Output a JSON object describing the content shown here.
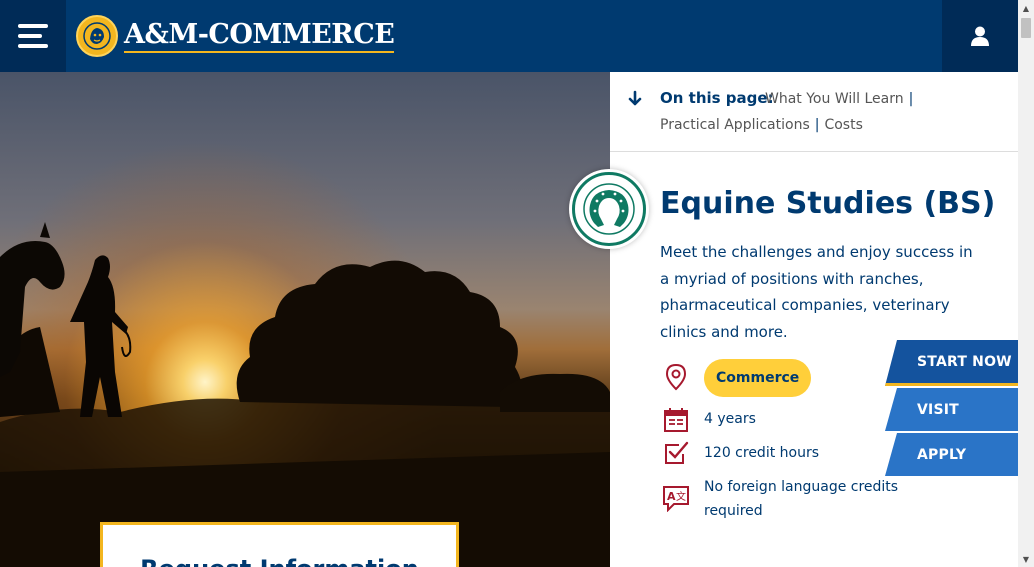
{
  "header": {
    "logo_text": "A&M-COMMERCE",
    "menu_icon": "hamburger-icon",
    "user_icon": "user-icon",
    "bg_color": "#003a70",
    "accent_color": "#f3b61f"
  },
  "on_this_page": {
    "label": "On this page:",
    "links": [
      "What You Will Learn",
      "Practical Applications",
      "Costs"
    ]
  },
  "program": {
    "title": "Equine Studies (BS)",
    "description": "Meet the challenges and enjoy success in a myriad of positions with ranches, pharmaceutical companies, veterinary clinics and more.",
    "icon": "horseshoe-icon",
    "campus": "Commerce",
    "duration": "4 years",
    "credits": "120 credit hours",
    "language": "No foreign language credits required"
  },
  "cta": {
    "start_now": "START NOW",
    "visit": "VISIT",
    "apply": "APPLY"
  },
  "request_info": {
    "title": "Request Information"
  }
}
